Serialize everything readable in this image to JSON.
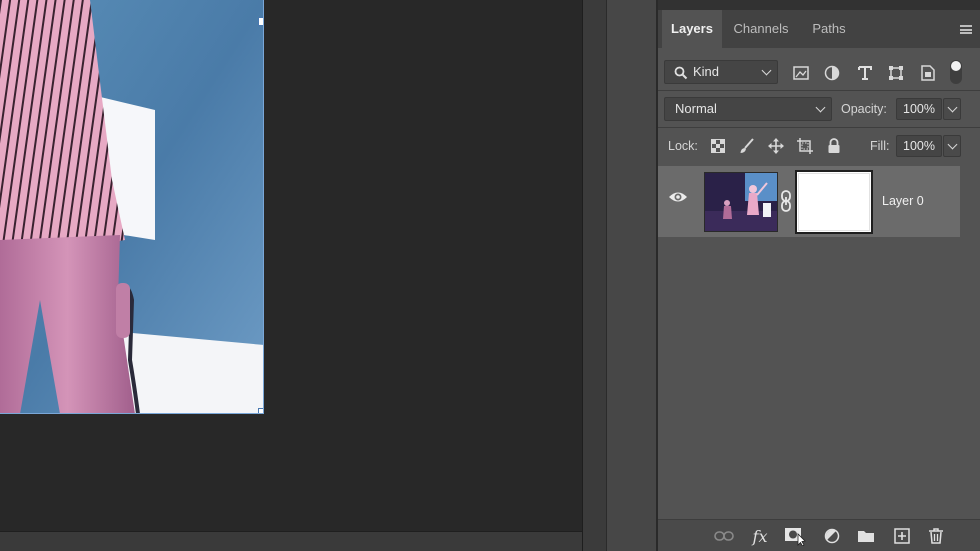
{
  "panel": {
    "tabs": [
      {
        "label": "Layers",
        "active": true
      },
      {
        "label": "Channels",
        "active": false
      },
      {
        "label": "Paths",
        "active": false
      }
    ],
    "menu_icon": "hamburger-icon"
  },
  "filter": {
    "kind_label": "Kind",
    "icons": [
      "pixel-filter-icon",
      "adjustment-filter-icon",
      "type-filter-icon",
      "shape-filter-icon",
      "smart-object-filter-icon"
    ],
    "toggle": "filter-toggle"
  },
  "blend": {
    "mode": "Normal",
    "opacity_label": "Opacity:",
    "opacity_value": "100%"
  },
  "lock": {
    "label": "Lock:",
    "icons": [
      "lock-transparent-icon",
      "lock-image-icon",
      "lock-position-icon",
      "lock-artboard-icon",
      "lock-all-icon"
    ],
    "fill_label": "Fill:",
    "fill_value": "100%"
  },
  "layers": [
    {
      "name": "Layer 0",
      "visible": true,
      "has_mask": true,
      "selected": true
    }
  ],
  "footer": {
    "buttons": [
      "link-layers-icon",
      "fx-icon",
      "add-mask-icon",
      "adjustment-layer-icon",
      "group-folder-icon",
      "new-layer-icon",
      "trash-icon"
    ],
    "fx_label": "fx"
  },
  "colors": {
    "panel_bg": "#535353",
    "canvas_bg": "#282828",
    "selected_row": "#6b6b6b",
    "selection_border": "#7aa7d8"
  }
}
